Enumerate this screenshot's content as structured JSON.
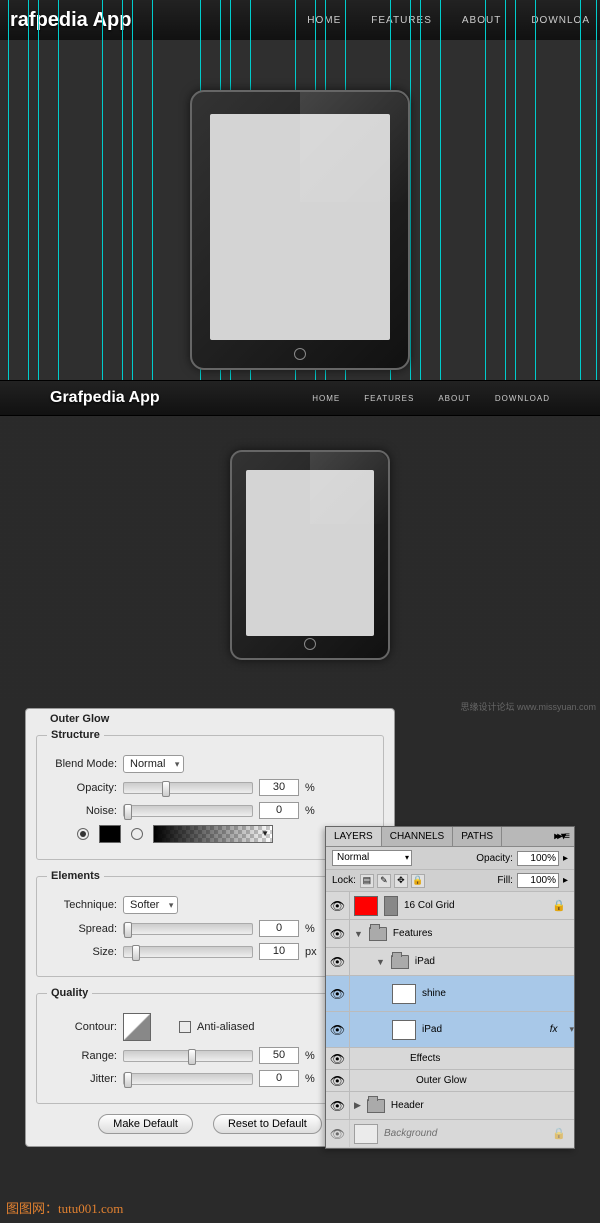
{
  "top": {
    "logo": "rafpedia App",
    "nav": [
      "HOME",
      "FEATURES",
      "ABOUT",
      "DOWNLOA"
    ]
  },
  "mid": {
    "logo": "Grafpedia App",
    "nav": [
      "HOME",
      "FEATURES",
      "ABOUT",
      "DOWNLOAD"
    ]
  },
  "dialog": {
    "title": "Outer Glow",
    "structure": {
      "legend": "Structure",
      "blend_mode_label": "Blend Mode:",
      "blend_mode": "Normal",
      "opacity_label": "Opacity:",
      "opacity": "30",
      "opacity_unit": "%",
      "noise_label": "Noise:",
      "noise": "0",
      "noise_unit": "%"
    },
    "elements": {
      "legend": "Elements",
      "technique_label": "Technique:",
      "technique": "Softer",
      "spread_label": "Spread:",
      "spread": "0",
      "spread_unit": "%",
      "size_label": "Size:",
      "size": "10",
      "size_unit": "px"
    },
    "quality": {
      "legend": "Quality",
      "contour_label": "Contour:",
      "antialiased": "Anti-aliased",
      "range_label": "Range:",
      "range": "50",
      "range_unit": "%",
      "jitter_label": "Jitter:",
      "jitter": "0",
      "jitter_unit": "%"
    },
    "make_default": "Make Default",
    "reset_default": "Reset to Default"
  },
  "layers": {
    "tabs": [
      "LAYERS",
      "CHANNELS",
      "PATHS"
    ],
    "menu_icon": "▸▸ ▾≡",
    "blend": "Normal",
    "opacity_label": "Opacity:",
    "opacity": "100%",
    "lock_label": "Lock:",
    "fill_label": "Fill:",
    "fill": "100%",
    "rows": {
      "grid": "16 Col Grid",
      "features": "Features",
      "ipad_folder": "iPad",
      "shine": "shine",
      "ipad_layer": "iPad",
      "fx": "fx",
      "effects": "Effects",
      "outer_glow": "Outer Glow",
      "header": "Header",
      "background": "Background"
    }
  },
  "watermark_left": "图图网：tutu001.com",
  "watermark_right": "思缘设计论坛  www.missyuan.com"
}
